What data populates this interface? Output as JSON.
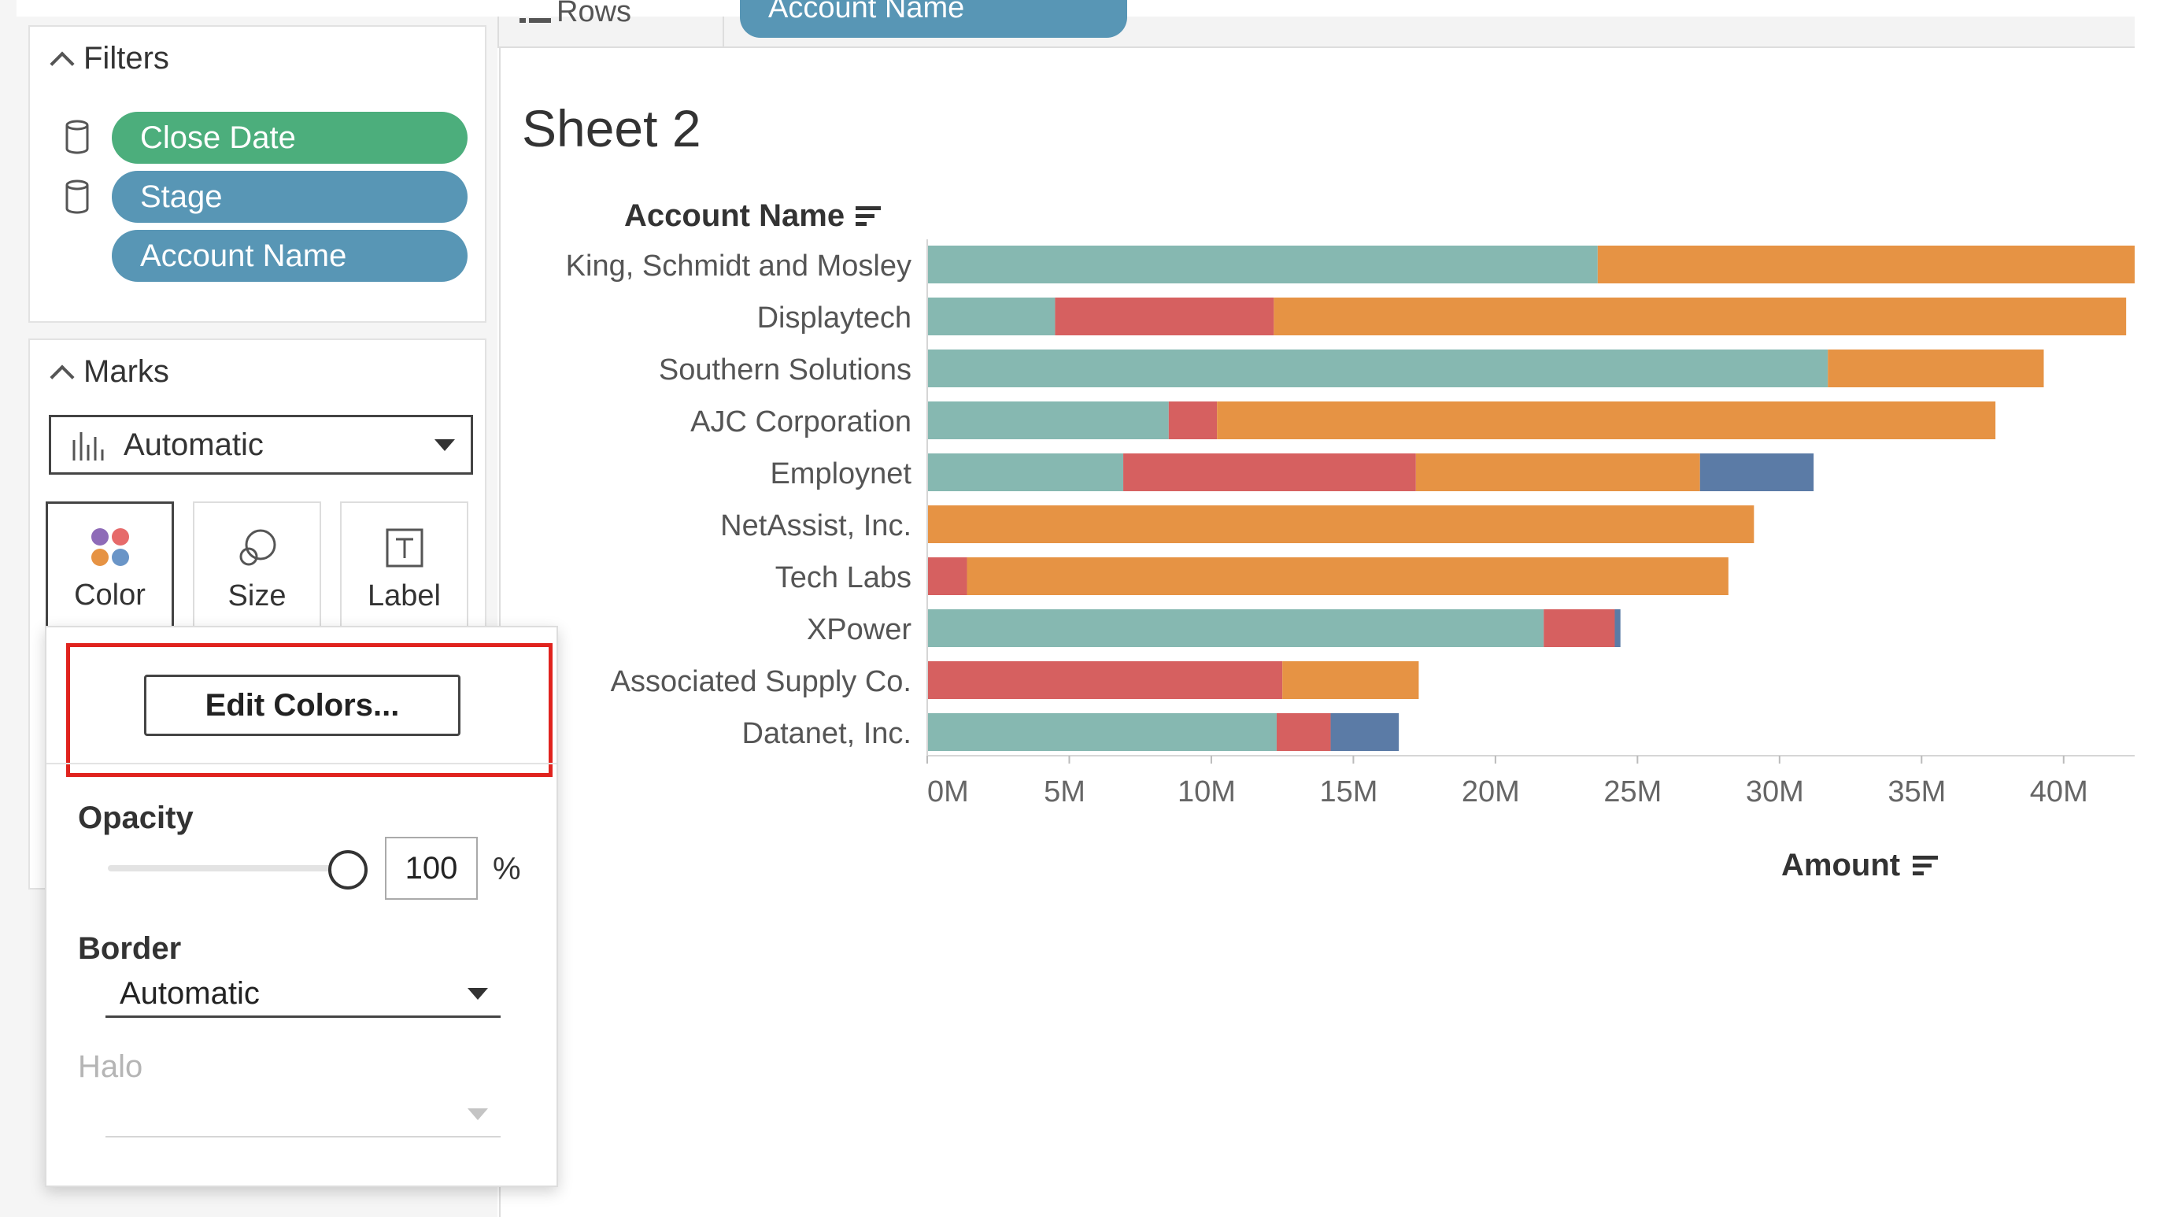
{
  "toolbar": {
    "rows_label": "Rows",
    "rows_pill": "Account Name"
  },
  "filters": {
    "title": "Filters",
    "items": [
      {
        "label": "Close Date",
        "color": "#4cae7c"
      },
      {
        "label": "Stage",
        "color": "#5896b5"
      },
      {
        "label": "Account Name",
        "color": "#5896b5"
      }
    ]
  },
  "marks": {
    "title": "Marks",
    "type_selected": "Automatic",
    "cards": [
      {
        "label": "Color",
        "icon": "color-dots-icon"
      },
      {
        "label": "Size",
        "icon": "size-circles-icon"
      },
      {
        "label": "Label",
        "icon": "text-label-icon"
      }
    ]
  },
  "color_popup": {
    "edit_colors_label": "Edit Colors...",
    "opacity_label": "Opacity",
    "opacity_value": "100",
    "opacity_unit": "%",
    "border_label": "Border",
    "border_value": "Automatic",
    "halo_label": "Halo",
    "halo_value": ""
  },
  "sheet": {
    "title": "Sheet 2",
    "row_header": "Account Name",
    "axis_title": "Amount"
  },
  "chart_data": {
    "type": "bar",
    "orientation": "horizontal",
    "stacked": true,
    "categories": [
      "King, Schmidt and Mosley",
      "Displaytech",
      "Southern Solutions",
      "AJC Corporation",
      "Employnet",
      "NetAssist, Inc.",
      "Tech Labs",
      "XPower",
      "Associated Supply Co.",
      "Datanet, Inc."
    ],
    "series": [
      {
        "color": "#86b8b1",
        "values": [
          23.6,
          4.5,
          31.7,
          8.5,
          6.9,
          0,
          0,
          21.7,
          0,
          12.3
        ]
      },
      {
        "color": "#d66060",
        "values": [
          0,
          7.7,
          0,
          1.7,
          10.3,
          0,
          1.4,
          2.5,
          12.5,
          1.9
        ]
      },
      {
        "color": "#e69344",
        "values": [
          18.9,
          30.0,
          7.6,
          27.4,
          10.0,
          29.1,
          26.8,
          0,
          4.8,
          0
        ]
      },
      {
        "color": "#5b7ba6",
        "values": [
          0,
          0,
          0,
          0,
          4.0,
          0,
          0,
          0.2,
          0,
          2.4
        ]
      }
    ],
    "x_ticks": [
      "0M",
      "5M",
      "10M",
      "15M",
      "20M",
      "25M",
      "30M",
      "35M",
      "40M"
    ],
    "x_range": [
      0,
      42.5
    ],
    "x_unit": "M",
    "xlabel": "Amount",
    "grid": false
  }
}
